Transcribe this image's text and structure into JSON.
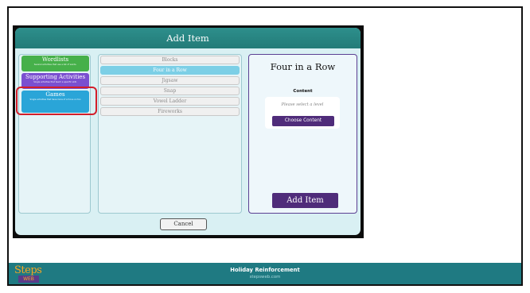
{
  "modal": {
    "title": "Add Item",
    "categories": [
      {
        "title": "Wordlists",
        "desc": "Several activities that use a list of words."
      },
      {
        "title": "Supporting Activities",
        "desc": "Single activities that teach a specific skill."
      },
      {
        "title": "Games",
        "desc": "Single activities that have more of a focus on fun"
      }
    ],
    "games": [
      "Blocks",
      "Four in a Row",
      "Jigsaw",
      "Snap",
      "Vowel Ladder",
      "Fireworks"
    ],
    "selected_game": "Four in a Row",
    "detail": {
      "title": "Four in a Row",
      "content_label": "Content",
      "hint": "Please select a level",
      "choose_label": "Choose Content",
      "add_label": "Add Item"
    },
    "cancel_label": "Cancel"
  },
  "footer": {
    "title": "Holiday Reinforcement",
    "subtitle": "stepsweb.com",
    "logo_top": "Steps",
    "logo_bottom": "WEB"
  },
  "colors": {
    "header": "#2d8f8c",
    "wordlists": "#46b04a",
    "supporting": "#7a4fd0",
    "games": "#2aa5d8",
    "selected_item": "#7ccfe6",
    "button_purple": "#4f2c7a",
    "highlight_ring": "#d31e2a",
    "footer": "#1f7a82"
  }
}
